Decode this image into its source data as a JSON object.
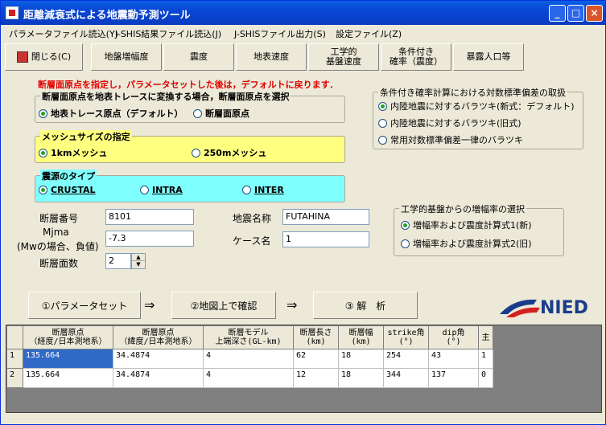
{
  "window": {
    "title": "距離減衰式による地震動予測ツール",
    "minimize": "_",
    "maximize": "□",
    "close": "×"
  },
  "menu": [
    "パラメータファイル読込(Y)",
    "J-SHIS結果ファイル読込(J)",
    "J-SHISファイル出力(S)",
    "設定ファイル(Z)"
  ],
  "toolbar": {
    "close": "閉じる(C)",
    "items": [
      "地盤増幅度",
      "震度",
      "地表速度",
      "工学的\n基盤速度",
      "条件付き\n確率（震度）",
      "暴露人口等"
    ]
  },
  "notice": "断層面原点を指定し，パラメータセットした後は，デフォルトに戻ります．",
  "origin_group": {
    "legend": "断層面原点を地表トレースに変換する場合，断層面原点を選択",
    "opt1": "地表トレース原点（デフォルト）",
    "opt2": "断層面原点"
  },
  "mesh_group": {
    "legend": "メッシュサイズの指定",
    "opt1": "1kmメッシュ",
    "opt2": "250mメッシュ"
  },
  "source_group": {
    "legend": "震源のタイプ",
    "opt1": "CRUSTAL",
    "opt2": "INTRA",
    "opt3": "INTER"
  },
  "prob_group": {
    "legend": "条件付き確率計算における対数標準偏差の取扱",
    "opt1": "内陸地震に対するバラツキ(新式：デフォルト)",
    "opt2": "内陸地震に対するバラツキ(旧式)",
    "opt3": "常用対数標準偏差一律のバラツキ"
  },
  "amp_group": {
    "legend": "工学的基盤からの増幅率の選択",
    "opt1": "増幅率および震度計算式1(新)",
    "opt2": "増幅率および震度計算式2(旧)"
  },
  "fields": {
    "fault_no_label": "断層番号",
    "fault_no": "8101",
    "mjma_label1": "Mjma",
    "mjma_label2": "(Mwの場合、負値)",
    "mjma": "-7.3",
    "faces_label": "断層面数",
    "faces": "2",
    "eq_name_label": "地震名称",
    "eq_name": "FUTAHINA",
    "case_label": "ケース名",
    "case": "1"
  },
  "actions": {
    "set": "①パラメータセット",
    "map": "②地図上で確認",
    "run": "③ 解　析",
    "arrow": "⇒"
  },
  "logo": "NIED",
  "table": {
    "headers": [
      "断層原点\n（経度/日本測地系）",
      "断層原点\n（緯度/日本測地系）",
      "断層モデル\n上端深さ(GL-km)",
      "断層長さ\n(km)",
      "断層幅\n(km)",
      "strike角\n(°)",
      "dip角\n(°)",
      "主"
    ],
    "rows": [
      [
        "1",
        "135.664",
        "34.4874",
        "4",
        "62",
        "18",
        "254",
        "43",
        "1"
      ],
      [
        "2",
        "135.664",
        "34.4874",
        "4",
        "12",
        "18",
        "344",
        "137",
        "0"
      ]
    ]
  }
}
